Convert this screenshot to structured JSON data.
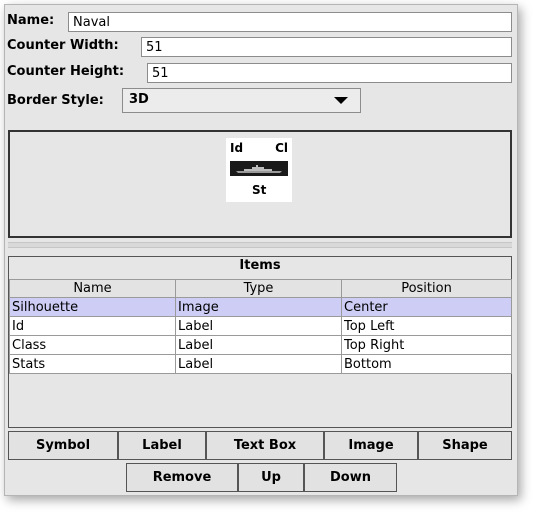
{
  "form": {
    "name_label": "Name:",
    "name_value": "Naval",
    "width_label": "Counter Width:",
    "width_value": "51",
    "height_label": "Counter Height:",
    "height_value": "51",
    "border_label": "Border Style:",
    "border_value": "3D"
  },
  "preview": {
    "top_left": "Id",
    "top_right": "Cl",
    "bottom": "St"
  },
  "items": {
    "title": "Items",
    "columns": [
      "Name",
      "Type",
      "Position"
    ],
    "rows": [
      [
        "Silhouette",
        "Image",
        "Center"
      ],
      [
        "Id",
        "Label",
        "Top Left"
      ],
      [
        "Class",
        "Label",
        "Top Right"
      ],
      [
        "Stats",
        "Label",
        "Bottom"
      ]
    ],
    "selected_row": 0
  },
  "buttons": {
    "symbol": "Symbol",
    "label": "Label",
    "text_box": "Text Box",
    "image": "Image",
    "shape": "Shape",
    "remove": "Remove",
    "up": "Up",
    "down": "Down"
  }
}
